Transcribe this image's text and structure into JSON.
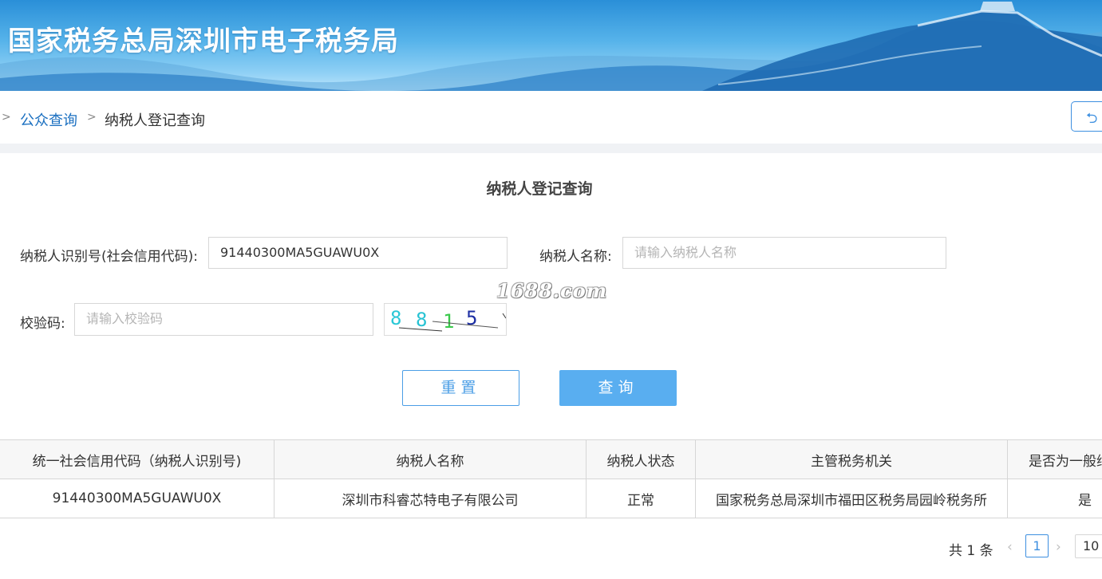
{
  "banner": {
    "title": "国家税务总局深圳市电子税务局"
  },
  "breadcrumb": {
    "separator": ">",
    "items": [
      {
        "label": "公众查询"
      },
      {
        "label": "纳税人登记查询"
      }
    ],
    "back_icon": "undo-icon"
  },
  "form": {
    "title": "纳税人登记查询",
    "taxpayer_id": {
      "label": "纳税人识别号(社会信用代码):",
      "value": "91440300MA5GUAWU0X"
    },
    "taxpayer_name": {
      "label": "纳税人名称:",
      "placeholder": "请输入纳税人名称",
      "value": ""
    },
    "captcha": {
      "label": "校验码:",
      "placeholder": "请输入校验码",
      "value": "",
      "image_text": "8815"
    },
    "watermark": "1688.com",
    "reset_label": "重置",
    "query_label": "查询"
  },
  "table": {
    "columns": [
      "统一社会信用代码（纳税人识别号)",
      "纳税人名称",
      "纳税人状态",
      "主管税务机关",
      "是否为一般纳"
    ],
    "rows": [
      [
        "91440300MA5GUAWU0X",
        "深圳市科睿芯特电子有限公司",
        "正常",
        "国家税务总局深圳市福田区税务局园岭税务所",
        "是"
      ]
    ]
  },
  "pagination": {
    "total_label": "共 1 条",
    "prev_icon": "chevron-left-icon",
    "current_page": "1",
    "next_icon": "chevron-right-icon",
    "page_size": "10"
  },
  "colors": {
    "accent": "#3d8fe0",
    "query_button": "#59aef0",
    "link": "#1a6fc0"
  }
}
